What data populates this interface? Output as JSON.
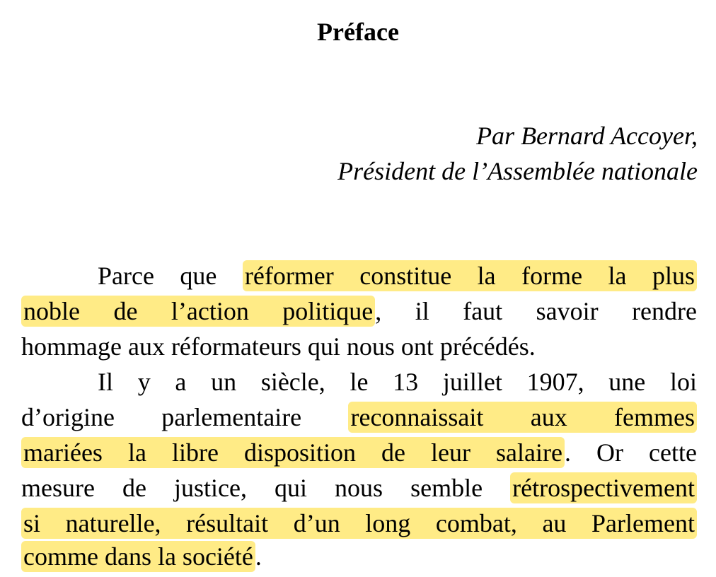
{
  "document": {
    "title": "Préface",
    "byline": {
      "author": "Par Bernard Accoyer,",
      "role": "Président de l’Assemblée nationale"
    },
    "highlight_color": "#ffde3c",
    "lines": [
      {
        "pre": "Parce que ",
        "hl": "réformer constitue la forme la plus",
        "post": ""
      },
      {
        "pre": "",
        "hl": "noble de l’action politique",
        "post": ", il faut savoir rendre"
      },
      {
        "pre": "hommage aux réformateurs qui nous ont précédés.",
        "hl": "",
        "post": ""
      },
      {
        "pre": "Il y a un siècle, le 13 juillet 1907, une loi",
        "hl": "",
        "post": ""
      },
      {
        "pre": "d’origine parlementaire ",
        "hl": "reconnaissait aux femmes",
        "post": ""
      },
      {
        "pre": "",
        "hl": "mariées la libre disposition de leur salaire",
        "post": ". Or cette"
      },
      {
        "pre": "mesure de justice, qui nous semble ",
        "hl": "rétrospectivement",
        "post": ""
      },
      {
        "pre": "",
        "hl": "si naturelle, résultait d’un long combat, au Parlement",
        "post": ""
      },
      {
        "pre": "",
        "hl": "comme dans la société",
        "post": "."
      }
    ]
  }
}
